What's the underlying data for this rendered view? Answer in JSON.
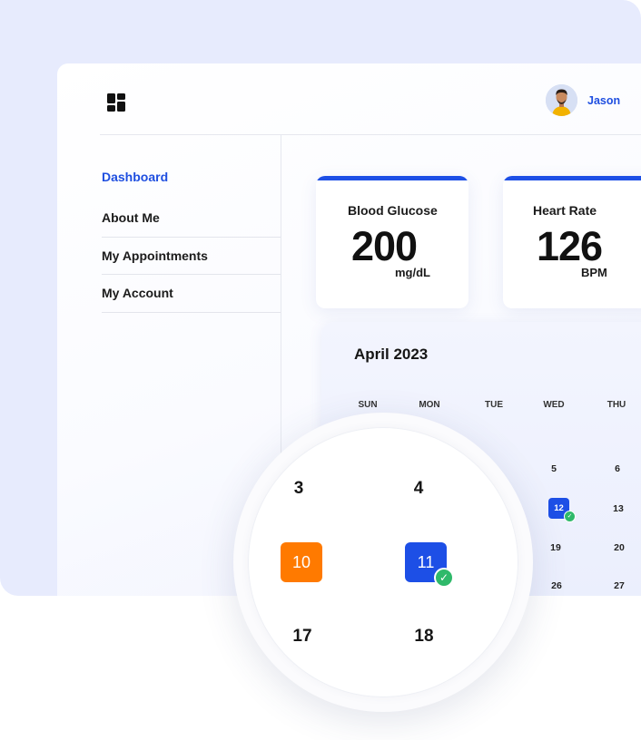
{
  "user": {
    "name": "Jason"
  },
  "sidebar": {
    "items": [
      {
        "label": "Dashboard",
        "active": true
      },
      {
        "label": "About Me"
      },
      {
        "label": "My Appointments"
      },
      {
        "label": "My Account"
      }
    ]
  },
  "metrics": [
    {
      "title": "Blood Glucose",
      "value": "200",
      "unit": "mg/dL"
    },
    {
      "title": "Heart Rate",
      "value": "126",
      "unit": "BPM"
    }
  ],
  "calendar": {
    "title": "April 2023",
    "weekdays": [
      "SUN",
      "MON",
      "TUE",
      "WED",
      "THU"
    ],
    "days": [
      "5",
      "6",
      "12",
      "13",
      "19",
      "20",
      "26",
      "27"
    ],
    "selected_day": "12",
    "magnified": {
      "days": [
        "3",
        "4",
        "10",
        "11",
        "17",
        "18"
      ],
      "highlight_today": "10",
      "selected": "11"
    }
  },
  "colors": {
    "accent": "#1d4fe6",
    "today": "#ff7a00",
    "check": "#2fb96a",
    "background": "#e7ebfd"
  },
  "icons": {
    "logo": "dashboard-grid-icon",
    "check": "check-icon"
  }
}
